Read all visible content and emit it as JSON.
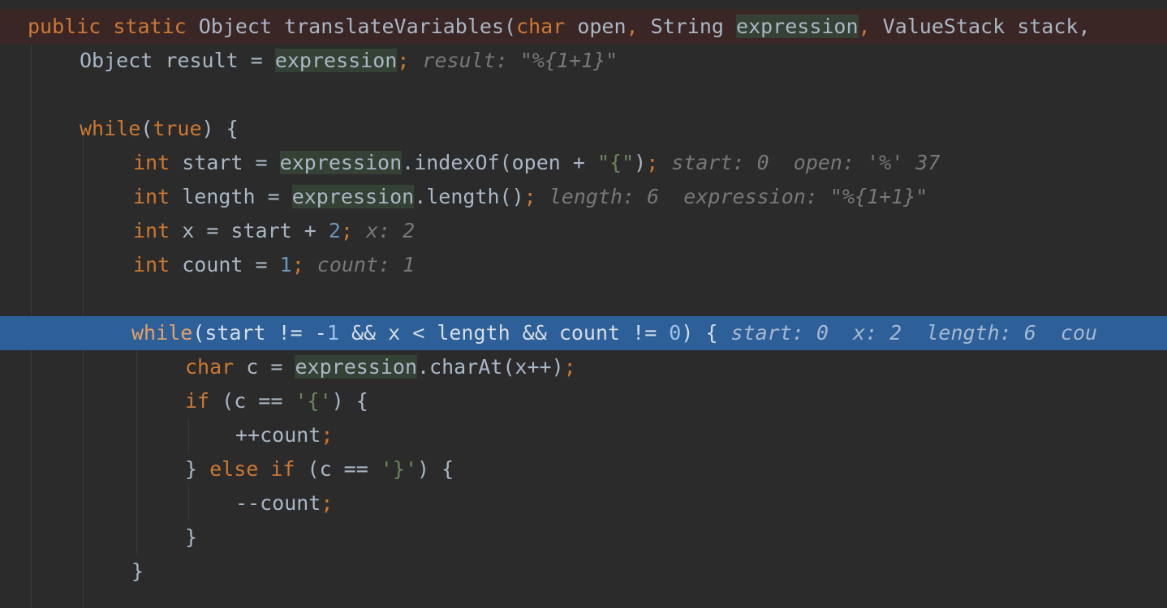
{
  "editor": {
    "lines": [
      {
        "kind": "error",
        "tokens": [
          [
            "kw",
            "public static "
          ],
          [
            "p",
            "Object translateVariables("
          ],
          [
            "kw",
            "char "
          ],
          [
            "p",
            "open"
          ],
          [
            "kw",
            ", "
          ],
          [
            "p",
            "String "
          ],
          [
            "hl",
            "expression"
          ],
          [
            "kw",
            ", "
          ],
          [
            "p",
            "ValueStack stack, "
          ]
        ]
      },
      {
        "tokens": [
          [
            "p",
            "Object result = "
          ],
          [
            "hl",
            "expression"
          ],
          [
            "kw",
            ";"
          ]
        ],
        "hint": "result: \"%{1+1}\""
      },
      {
        "tokens": []
      },
      {
        "tokens": [
          [
            "kw",
            "while"
          ],
          [
            "p",
            "("
          ],
          [
            "kw",
            "true"
          ],
          [
            "p",
            ") {"
          ]
        ]
      },
      {
        "tokens": [
          [
            "kw",
            "int "
          ],
          [
            "p",
            "start = "
          ],
          [
            "hl",
            "expression"
          ],
          [
            "p",
            ".indexOf(open + "
          ],
          [
            "str",
            "\"{\""
          ],
          [
            "p",
            ")"
          ],
          [
            "kw",
            ";"
          ]
        ],
        "hint": "start: 0  open: '%' 37"
      },
      {
        "tokens": [
          [
            "kw",
            "int "
          ],
          [
            "p",
            "length = "
          ],
          [
            "hl",
            "expression"
          ],
          [
            "p",
            ".length()"
          ],
          [
            "kw",
            ";"
          ]
        ],
        "hint": "length: 6  expression: \"%{1+1}\""
      },
      {
        "tokens": [
          [
            "kw",
            "int "
          ],
          [
            "p",
            "x = start + "
          ],
          [
            "num",
            "2"
          ],
          [
            "kw",
            ";"
          ]
        ],
        "hint": "x: 2"
      },
      {
        "tokens": [
          [
            "kw",
            "int "
          ],
          [
            "p",
            "count = "
          ],
          [
            "num",
            "1"
          ],
          [
            "kw",
            ";"
          ]
        ],
        "hint": "count: 1"
      },
      {
        "tokens": []
      },
      {
        "kind": "exec",
        "tokens": [
          [
            "kw",
            "while"
          ],
          [
            "p",
            "(start != -"
          ],
          [
            "num",
            "1"
          ],
          [
            "p",
            " && x < length && count != "
          ],
          [
            "num",
            "0"
          ],
          [
            "p",
            ") {"
          ]
        ],
        "hint": "start: 0  x: 2  length: 6  cou"
      },
      {
        "tokens": [
          [
            "kw",
            "char "
          ],
          [
            "p",
            "c = "
          ],
          [
            "hl",
            "expression"
          ],
          [
            "p",
            ".charAt(x++)"
          ],
          [
            "kw",
            ";"
          ]
        ]
      },
      {
        "tokens": [
          [
            "kw",
            "if "
          ],
          [
            "p",
            "(c == "
          ],
          [
            "str",
            "'{'"
          ],
          [
            "p",
            ") {"
          ]
        ]
      },
      {
        "tokens": [
          [
            "p",
            "++count"
          ],
          [
            "kw",
            ";"
          ]
        ]
      },
      {
        "tokens": [
          [
            "p",
            "} "
          ],
          [
            "kw",
            "else if "
          ],
          [
            "p",
            "(c == "
          ],
          [
            "str",
            "'}'"
          ],
          [
            "p",
            ") {"
          ]
        ]
      },
      {
        "tokens": [
          [
            "p",
            "--count"
          ],
          [
            "kw",
            ";"
          ]
        ]
      },
      {
        "tokens": [
          [
            "p",
            "}"
          ]
        ]
      },
      {
        "tokens": [
          [
            "p",
            "}"
          ]
        ]
      }
    ]
  }
}
